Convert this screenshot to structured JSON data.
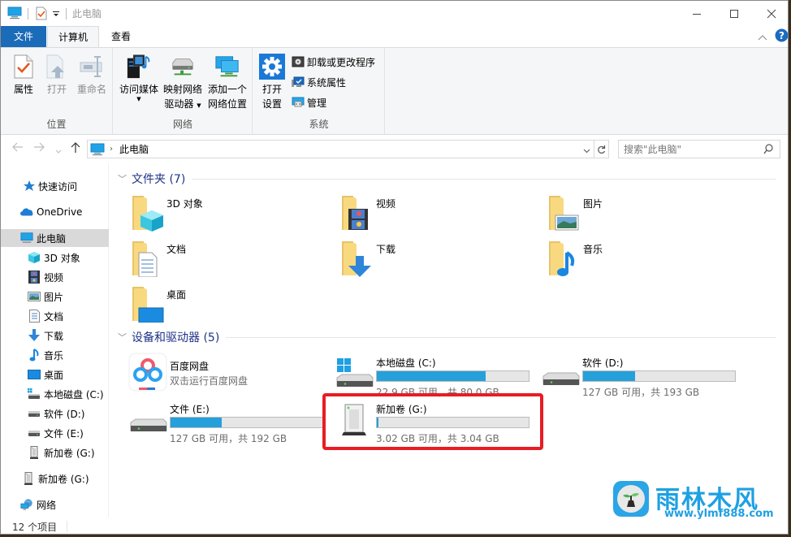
{
  "window": {
    "title": "此电脑",
    "controls": {
      "minimize": "minimize",
      "maximize": "maximize",
      "close": "close"
    }
  },
  "ribbon": {
    "tabs": [
      {
        "label": "文件",
        "active": false
      },
      {
        "label": "计算机",
        "active": true
      },
      {
        "label": "查看",
        "active": false
      }
    ],
    "groups": [
      {
        "label": "位置",
        "buttons": [
          {
            "label": "属性",
            "icon": "properties-icon",
            "enabled": true
          },
          {
            "label": "打开",
            "icon": "open-icon",
            "enabled": false
          },
          {
            "label": "重命名",
            "icon": "rename-icon",
            "enabled": false
          }
        ]
      },
      {
        "label": "网络",
        "buttons": [
          {
            "label": "访问媒体",
            "icon": "media-icon",
            "dropdown": true
          },
          {
            "label_line1": "映射网络",
            "label_line2": "驱动器",
            "icon": "map-drive-icon",
            "dropdown": true
          },
          {
            "label_line1": "添加一个",
            "label_line2": "网络位置",
            "icon": "network-location-icon"
          }
        ]
      },
      {
        "label": "系统",
        "buttons": [
          {
            "label_line1": "打开",
            "label_line2": "设置",
            "icon": "settings-icon"
          }
        ],
        "small_buttons": [
          {
            "label": "卸载或更改程序",
            "icon": "uninstall-icon"
          },
          {
            "label": "系统属性",
            "icon": "system-properties-icon"
          },
          {
            "label": "管理",
            "icon": "manage-icon"
          }
        ]
      }
    ]
  },
  "address": {
    "path": [
      "此电脑"
    ],
    "search_placeholder": "搜索\"此电脑\""
  },
  "navpane": {
    "items": [
      {
        "label": "快速访问",
        "icon": "star-icon",
        "level": 0
      },
      {
        "label": "OneDrive",
        "icon": "cloud-icon",
        "level": 0
      },
      {
        "label": "此电脑",
        "icon": "computer-icon",
        "level": 0,
        "selected": true
      },
      {
        "label": "3D 对象",
        "icon": "cube-icon",
        "level": 1
      },
      {
        "label": "视频",
        "icon": "video-icon",
        "level": 1
      },
      {
        "label": "图片",
        "icon": "picture-icon",
        "level": 1
      },
      {
        "label": "文档",
        "icon": "document-icon",
        "level": 1
      },
      {
        "label": "下载",
        "icon": "download-icon",
        "level": 1
      },
      {
        "label": "音乐",
        "icon": "music-icon",
        "level": 1
      },
      {
        "label": "桌面",
        "icon": "desktop-icon",
        "level": 1
      },
      {
        "label": "本地磁盘 (C:)",
        "icon": "system-drive-icon",
        "level": 1
      },
      {
        "label": "软件 (D:)",
        "icon": "drive-icon",
        "level": 1
      },
      {
        "label": "文件 (E:)",
        "icon": "drive-icon",
        "level": 1
      },
      {
        "label": "新加卷 (G:)",
        "icon": "usb-drive-icon",
        "level": 1
      },
      {
        "label": "新加卷 (G:)",
        "icon": "usb-drive-icon",
        "level": 0
      },
      {
        "label": "网络",
        "icon": "network-icon",
        "level": 0
      }
    ]
  },
  "content": {
    "folders_header": "文件夹 (7)",
    "folders": [
      {
        "name": "3D 对象",
        "icon": "3d-objects-folder-icon"
      },
      {
        "name": "视频",
        "icon": "videos-folder-icon"
      },
      {
        "name": "图片",
        "icon": "pictures-folder-icon"
      },
      {
        "name": "文档",
        "icon": "documents-folder-icon"
      },
      {
        "name": "下载",
        "icon": "downloads-folder-icon"
      },
      {
        "name": "音乐",
        "icon": "music-folder-icon"
      },
      {
        "name": "桌面",
        "icon": "desktop-folder-icon"
      }
    ],
    "devices_header": "设备和驱动器 (5)",
    "baidu": {
      "name": "百度网盘",
      "subtitle": "双击运行百度网盘"
    },
    "drives": [
      {
        "name": "本地磁盘 (C:)",
        "free": "22.9 GB 可用，共 80.0 GB",
        "used_fraction": 0.714,
        "icon": "system-drive-icon"
      },
      {
        "name": "软件 (D:)",
        "free": "127 GB 可用，共 193 GB",
        "used_fraction": 0.342,
        "icon": "drive-icon"
      },
      {
        "name": "文件 (E:)",
        "free": "127 GB 可用，共 192 GB",
        "used_fraction": 0.339,
        "icon": "drive-icon"
      },
      {
        "name": "新加卷 (G:)",
        "free": "3.02 GB 可用，共 3.04 GB",
        "used_fraction": 0.007,
        "icon": "usb-drive-icon",
        "highlighted": true
      }
    ]
  },
  "status": {
    "item_count": "12 个项目"
  },
  "watermark": {
    "title": "雨林木风",
    "url": "www.ylmf888.com"
  },
  "colors": {
    "accent": "#1a6bb8",
    "bar_fill": "#26a0da",
    "highlight": "#e81c24",
    "section_header": "#1e3287"
  }
}
